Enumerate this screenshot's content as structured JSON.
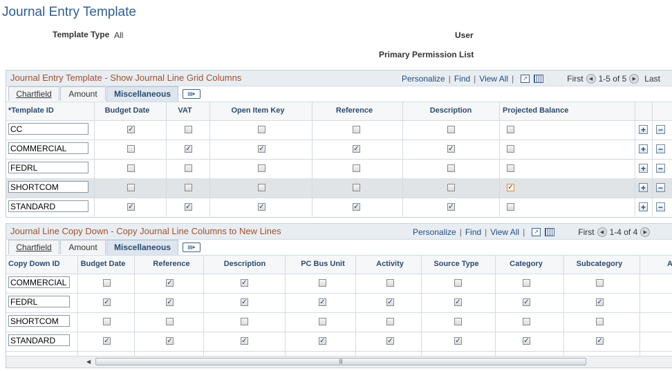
{
  "page": {
    "title": "Journal Entry Template",
    "template_type_label": "Template Type",
    "template_type_value": "All",
    "user_label": "User",
    "permission_label": "Primary Permission List"
  },
  "grid1": {
    "title": "Journal Entry Template - Show Journal Line Grid Columns",
    "personalize": "Personalize",
    "find": "Find",
    "view_all": "View All",
    "first": "First",
    "range": "1-5 of 5",
    "last": "Last",
    "tabs": [
      "Chartfield",
      "Amount",
      "Miscellaneous"
    ],
    "columns": [
      "*Template ID",
      "Budget Date",
      "VAT",
      "Open Item Key",
      "Reference",
      "Description",
      "Projected Balance"
    ],
    "rows": [
      {
        "id": "CC",
        "checks": [
          true,
          false,
          false,
          false,
          false,
          false
        ]
      },
      {
        "id": "COMMERCIAL",
        "checks": [
          false,
          true,
          true,
          true,
          true,
          false
        ]
      },
      {
        "id": "FEDRL",
        "checks": [
          false,
          false,
          false,
          false,
          false,
          false
        ]
      },
      {
        "id": "SHORTCOM",
        "checks": [
          false,
          false,
          false,
          false,
          false,
          true
        ]
      },
      {
        "id": "STANDARD",
        "checks": [
          true,
          true,
          true,
          true,
          true,
          false
        ]
      }
    ]
  },
  "grid2": {
    "title": "Journal Line Copy Down - Copy Journal Line Columns to New Lines",
    "personalize": "Personalize",
    "find": "Find",
    "view_all": "View All",
    "first": "First",
    "range": "1-4 of 4",
    "tabs": [
      "Chartfield",
      "Amount",
      "Miscellaneous"
    ],
    "columns": [
      "Copy Down ID",
      "Budget Date",
      "Reference",
      "Description",
      "PC Bus Unit",
      "Activity",
      "Source Type",
      "Category",
      "Subcategory",
      "A"
    ],
    "rows": [
      {
        "id": "COMMERCIAL",
        "checks": [
          false,
          true,
          true,
          false,
          false,
          false,
          false,
          false
        ]
      },
      {
        "id": "FEDRL",
        "checks": [
          true,
          true,
          true,
          true,
          true,
          true,
          true,
          true
        ]
      },
      {
        "id": "SHORTCOM",
        "checks": [
          false,
          false,
          false,
          false,
          false,
          false,
          false,
          false
        ]
      },
      {
        "id": "STANDARD",
        "checks": [
          true,
          true,
          true,
          true,
          true,
          true,
          true,
          true
        ]
      }
    ]
  },
  "icons": {
    "add": "plus-icon",
    "delete": "minus-icon",
    "zoom": "zoom-icon",
    "grid": "grid-download-icon",
    "prev": "previous-icon",
    "next": "next-icon",
    "show_all_tabs": "show-all-columns-icon"
  }
}
